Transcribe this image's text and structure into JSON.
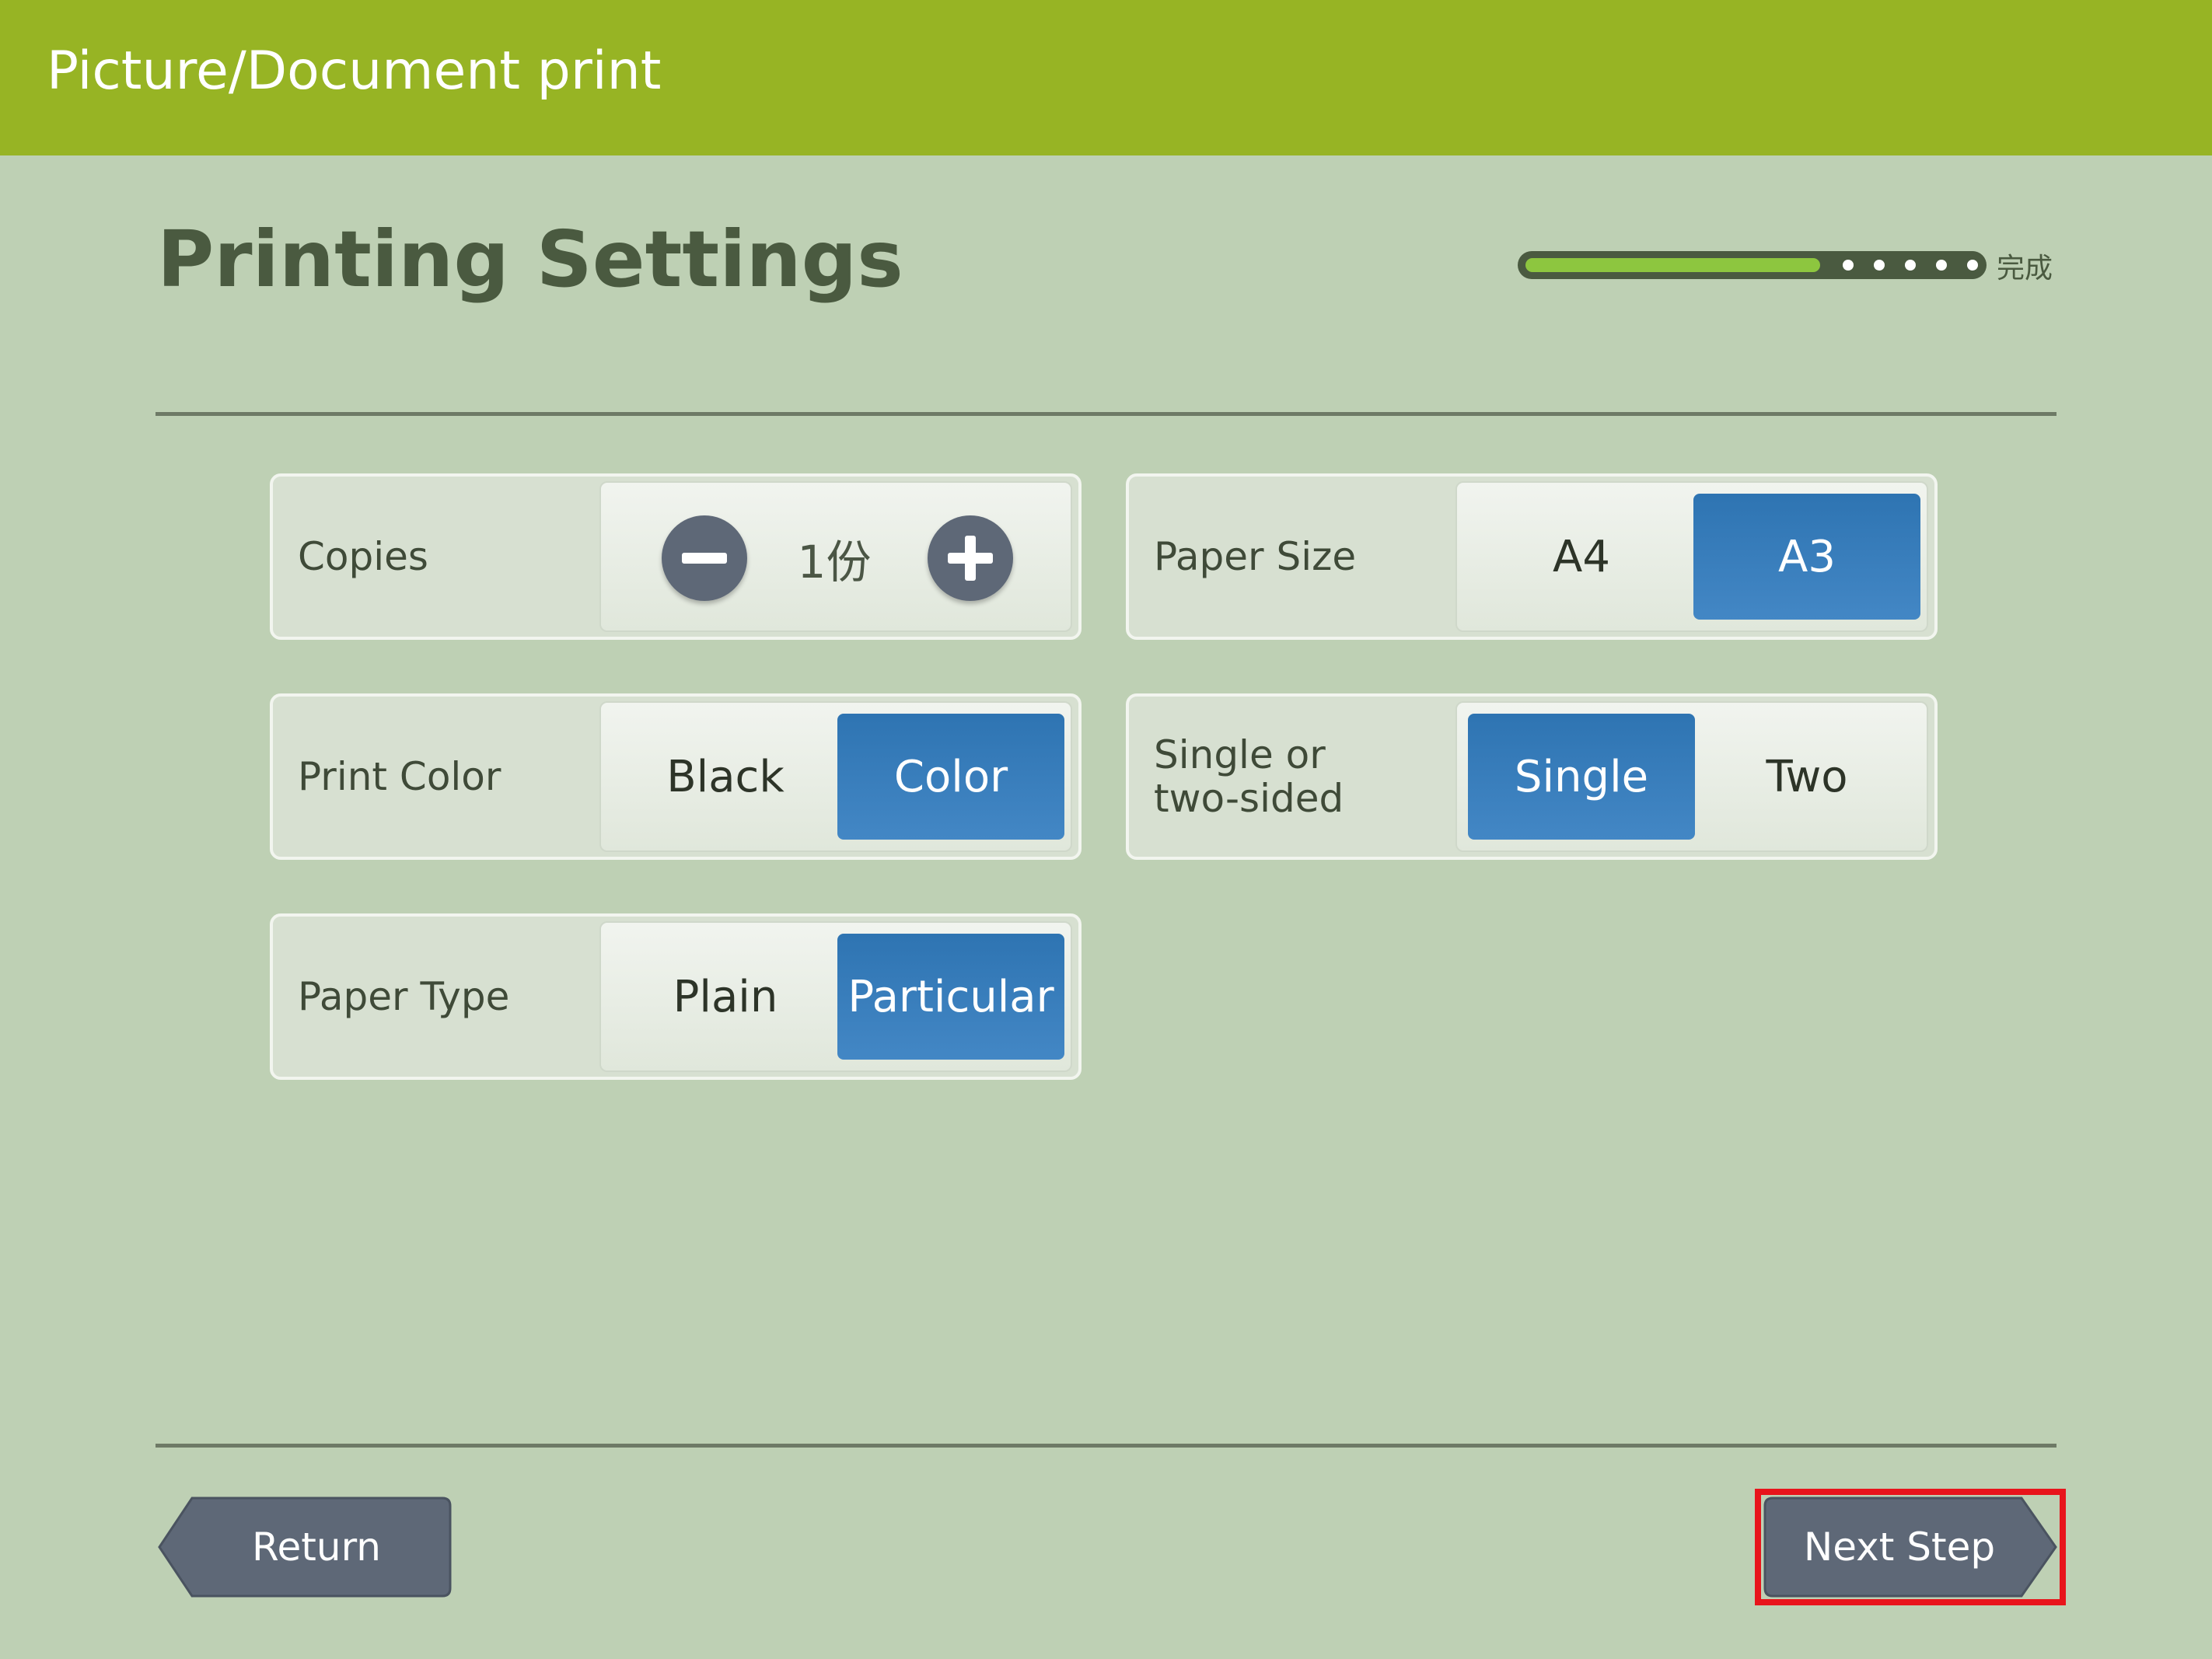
{
  "header": {
    "title": "Picture/Document print"
  },
  "page": {
    "title": "Printing Settings"
  },
  "progress": {
    "value": 0.65,
    "dots": 5,
    "label": "完成"
  },
  "settings": {
    "copies": {
      "label": "Copies",
      "value": "1份"
    },
    "paper_size": {
      "label": "Paper Size",
      "options": [
        "A4",
        "A3"
      ],
      "selected": "A3"
    },
    "print_color": {
      "label": "Print Color",
      "options": [
        "Black",
        "Color"
      ],
      "selected": "Color"
    },
    "sides": {
      "label": "Single or\ntwo-sided",
      "options": [
        "Single",
        "Two"
      ],
      "selected": "Single"
    },
    "paper_type": {
      "label": "Paper Type",
      "options": [
        "Plain",
        "Particular"
      ],
      "selected": "Particular"
    }
  },
  "footer": {
    "return_label": "Return",
    "next_label": "Next Step"
  },
  "colors": {
    "header_bg": "#97b424",
    "page_bg": "#bed0b4",
    "selected_bg": "#3a7dbd",
    "button_bg": "#5e6877",
    "highlight": "#e8141b"
  }
}
